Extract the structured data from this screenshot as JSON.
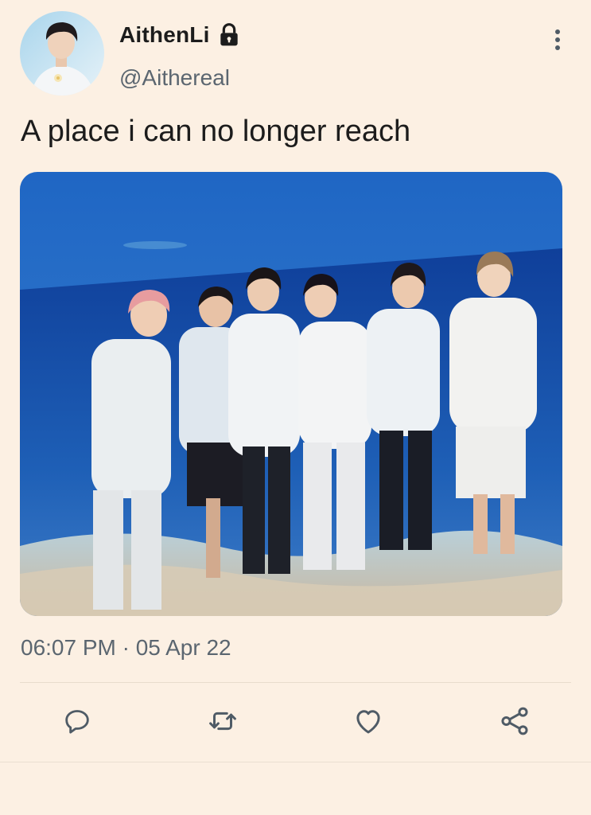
{
  "tweet": {
    "display_name": "AithenLi",
    "handle": "@Aithereal",
    "text": "A place i can no longer reach",
    "timestamp": "06:07 PM · 05 Apr 22"
  },
  "icons": {
    "protected": "lock-icon",
    "menu": "more-vertical-icon",
    "reply": "reply-icon",
    "retweet": "retweet-icon",
    "like": "heart-icon",
    "share": "share-icon"
  },
  "colors": {
    "background": "#fcf0e3",
    "text": "#1c1c1c",
    "secondary_text": "#5b6670",
    "icon": "#4f5b66"
  }
}
